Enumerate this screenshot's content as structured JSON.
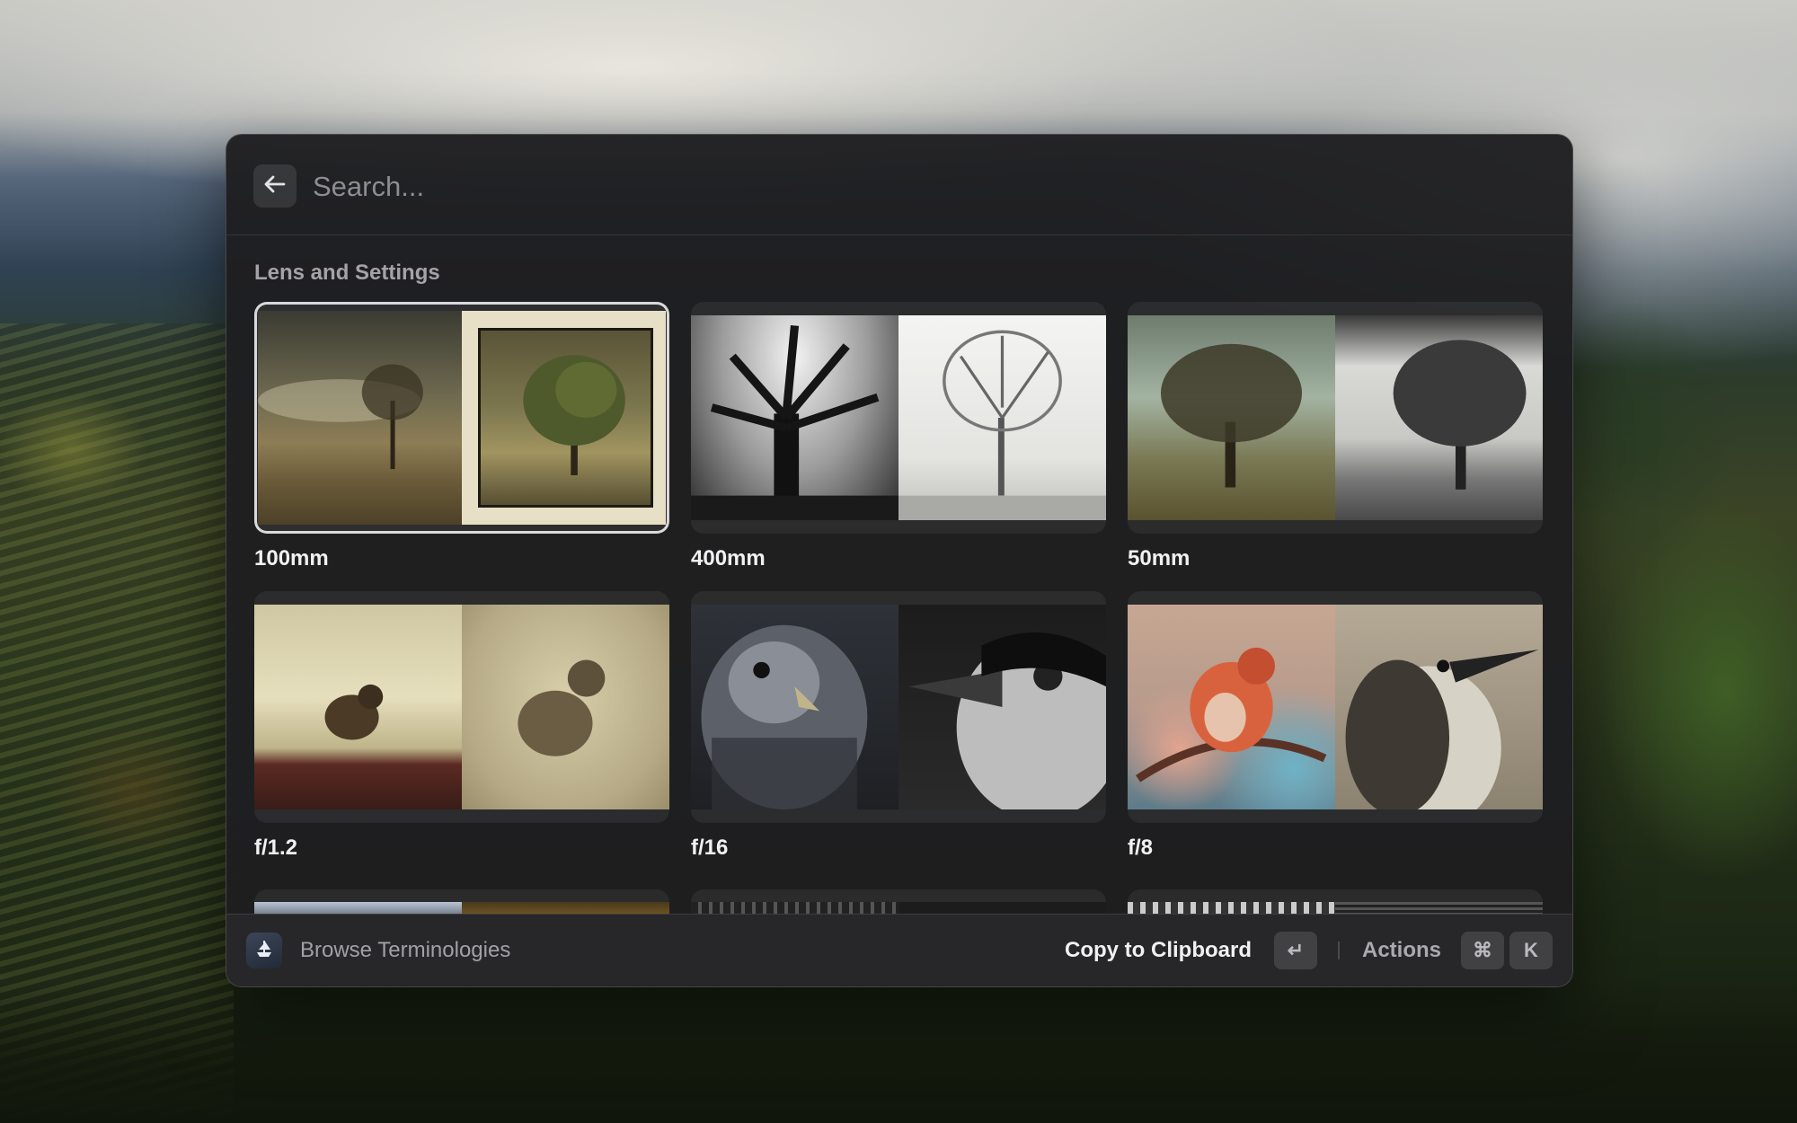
{
  "search": {
    "placeholder": "Search..."
  },
  "section": {
    "title": "Lens and Settings"
  },
  "items": [
    {
      "label": "100mm",
      "selected": true
    },
    {
      "label": "400mm",
      "selected": false
    },
    {
      "label": "50mm",
      "selected": false
    },
    {
      "label": "f/1.2",
      "selected": false
    },
    {
      "label": "f/16",
      "selected": false
    },
    {
      "label": "f/8",
      "selected": false
    }
  ],
  "footer": {
    "extension_title": "Browse Terminologies",
    "primary_action": "Copy to Clipboard",
    "primary_shortcut": "↵",
    "actions_label": "Actions",
    "actions_shortcut_mod": "⌘",
    "actions_shortcut_key": "K"
  },
  "icons": {
    "back": "arrow-left-icon",
    "extension": "ship-wheel-icon",
    "enter": "return-key-icon",
    "command": "command-key-icon"
  }
}
